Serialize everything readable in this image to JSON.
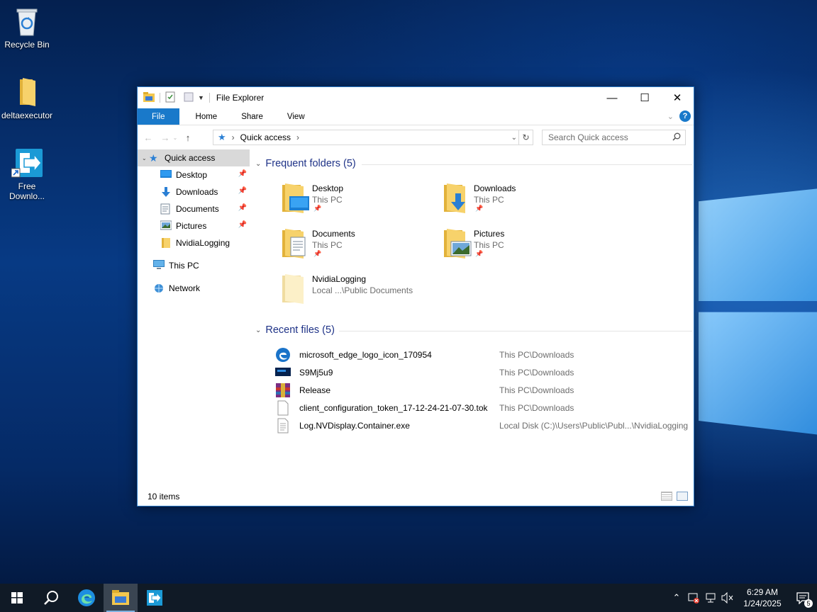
{
  "desktop": {
    "icons": [
      {
        "label": "Recycle Bin",
        "icon": "recycle-bin-icon"
      },
      {
        "label": "deltaexecutor",
        "icon": "folder-icon"
      },
      {
        "label": "Free Downlo...",
        "label_line1": "Free",
        "label_line2": "Downlo...",
        "icon": "free-download-manager-icon"
      }
    ]
  },
  "window": {
    "title": "File Explorer",
    "controls": {
      "minimize": "—",
      "maximize": "☐",
      "close": "✕"
    },
    "ribbon": {
      "tabs": [
        "File",
        "Home",
        "Share",
        "View"
      ],
      "help_label": "?"
    },
    "address": {
      "location": "Quick access",
      "separator": "›"
    },
    "search": {
      "placeholder": "Search Quick access"
    },
    "nav_pane": {
      "quick_access": "Quick access",
      "pinned": [
        {
          "label": "Desktop",
          "pinned": true
        },
        {
          "label": "Downloads",
          "pinned": true
        },
        {
          "label": "Documents",
          "pinned": true
        },
        {
          "label": "Pictures",
          "pinned": true
        },
        {
          "label": "NvidiaLogging",
          "pinned": false
        }
      ],
      "this_pc": "This PC",
      "network": "Network"
    },
    "frequent": {
      "header": "Frequent folders (5)",
      "folders": [
        {
          "name": "Desktop",
          "location": "This PC",
          "pinned": true
        },
        {
          "name": "Downloads",
          "location": "This PC",
          "pinned": true
        },
        {
          "name": "Documents",
          "location": "This PC",
          "pinned": true
        },
        {
          "name": "Pictures",
          "location": "This PC",
          "pinned": true
        },
        {
          "name": "NvidiaLogging",
          "location": "Local ...\\Public Documents",
          "pinned": false
        }
      ]
    },
    "recent": {
      "header": "Recent files (5)",
      "files": [
        {
          "name": "microsoft_edge_logo_icon_170954",
          "path": "This PC\\Downloads",
          "icon": "edge-icon"
        },
        {
          "name": "S9Mj5u9",
          "path": "This PC\\Downloads",
          "icon": "image-file-icon"
        },
        {
          "name": "Release",
          "path": "This PC\\Downloads",
          "icon": "winrar-archive-icon"
        },
        {
          "name": "client_configuration_token_17-12-24-21-07-30.tok",
          "path": "This PC\\Downloads",
          "icon": "blank-file-icon"
        },
        {
          "name": "Log.NVDisplay.Container.exe",
          "path": "Local Disk (C:)\\Users\\Public\\Publ...\\NvidiaLogging",
          "icon": "text-file-icon"
        }
      ]
    },
    "status": {
      "items": "10 items"
    }
  },
  "taskbar": {
    "apps": [
      "start-icon",
      "search-icon",
      "edge-icon",
      "file-explorer-icon",
      "free-download-manager-icon"
    ],
    "clock": {
      "time": "6:29 AM",
      "date": "1/24/2025"
    },
    "notification_count": "5"
  }
}
